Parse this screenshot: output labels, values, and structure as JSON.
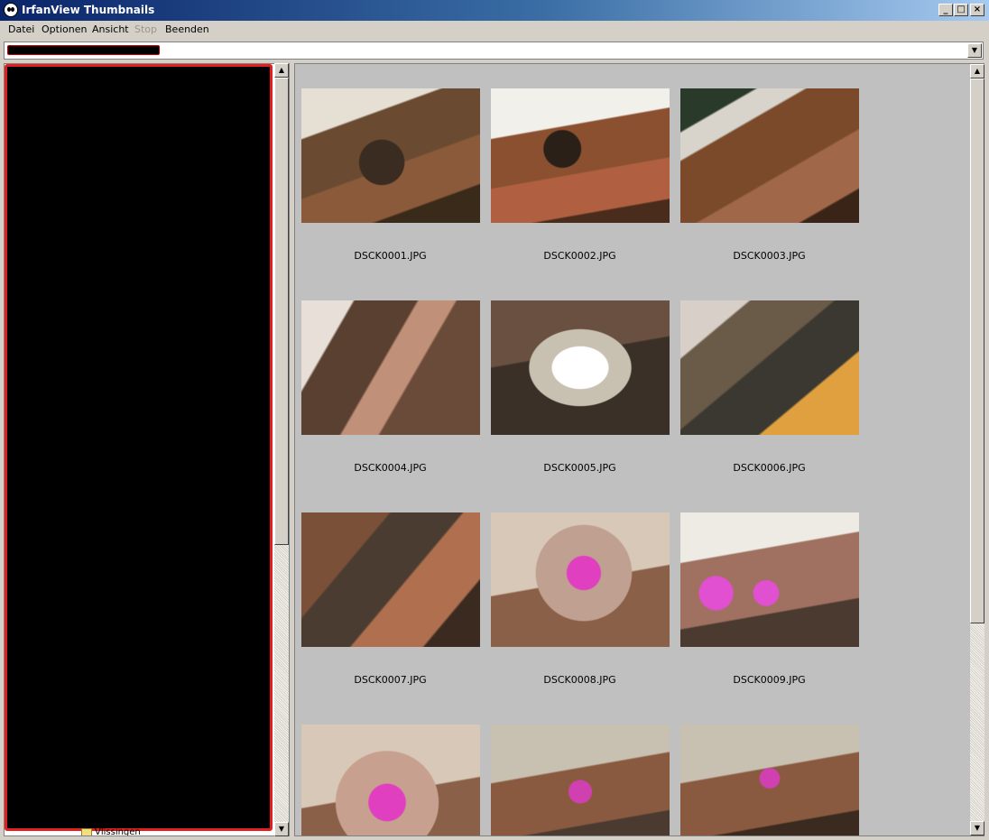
{
  "window": {
    "title": "IrfanView Thumbnails"
  },
  "menu": {
    "items": [
      {
        "label": "Datei"
      },
      {
        "label": "Optionen"
      },
      {
        "label": "Ansicht"
      },
      {
        "label": "Stop",
        "disabled": true
      },
      {
        "label": "Beenden"
      }
    ]
  },
  "tree": {
    "partial_item": "Vlissingen"
  },
  "thumbnails": [
    {
      "filename": "DSCK0001.JPG"
    },
    {
      "filename": "DSCK0002.JPG"
    },
    {
      "filename": "DSCK0003.JPG"
    },
    {
      "filename": "DSCK0004.JPG"
    },
    {
      "filename": "DSCK0005.JPG"
    },
    {
      "filename": "DSCK0006.JPG"
    },
    {
      "filename": "DSCK0007.JPG"
    },
    {
      "filename": "DSCK0008.JPG"
    },
    {
      "filename": "DSCK0009.JPG"
    },
    {
      "filename": ""
    },
    {
      "filename": ""
    },
    {
      "filename": ""
    }
  ]
}
